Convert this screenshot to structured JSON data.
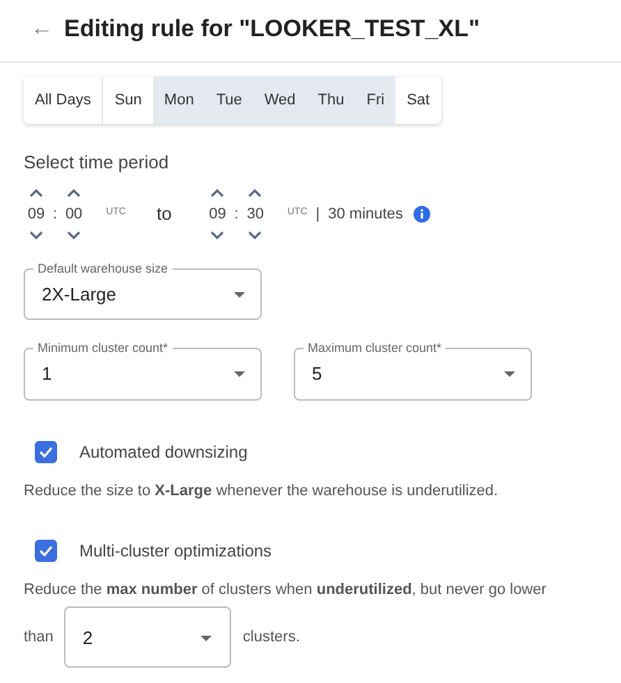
{
  "header": {
    "back": "←",
    "title": "Editing rule for \"LOOKER_TEST_XL\""
  },
  "days": [
    {
      "label": "All Days",
      "selected": false
    },
    {
      "label": "Sun",
      "selected": false
    },
    {
      "label": "Mon",
      "selected": true
    },
    {
      "label": "Tue",
      "selected": true
    },
    {
      "label": "Wed",
      "selected": true
    },
    {
      "label": "Thu",
      "selected": true
    },
    {
      "label": "Fri",
      "selected": true
    },
    {
      "label": "Sat",
      "selected": false
    }
  ],
  "time_period": {
    "label": "Select time period",
    "start": {
      "hours": "09",
      "separator": ":",
      "minutes": "00",
      "zone": "UTC"
    },
    "to": "to",
    "end": {
      "hours": "09",
      "separator": ":",
      "minutes": "30",
      "zone": "UTC"
    },
    "divider": "|",
    "duration": "30 minutes"
  },
  "warehouse_size": {
    "label": "Default warehouse size",
    "value": "2X-Large"
  },
  "cluster_counts": [
    {
      "label": "Minimum cluster count*",
      "value": "1"
    },
    {
      "label": "Maximum cluster count*",
      "value": "5"
    }
  ],
  "options": [
    {
      "label": "Automated downsizing",
      "checked": true,
      "description": "Reduce the size to **X-Large** whenever the warehouse is underutilized."
    },
    {
      "label": "Multi-cluster optimizations",
      "checked": true,
      "description": "Reduce the **max number** of clusters when **underutilized**, but never go lower"
    }
  ],
  "min_clusters": {
    "prefix": "than",
    "value": "2",
    "suffix": "clusters."
  }
}
